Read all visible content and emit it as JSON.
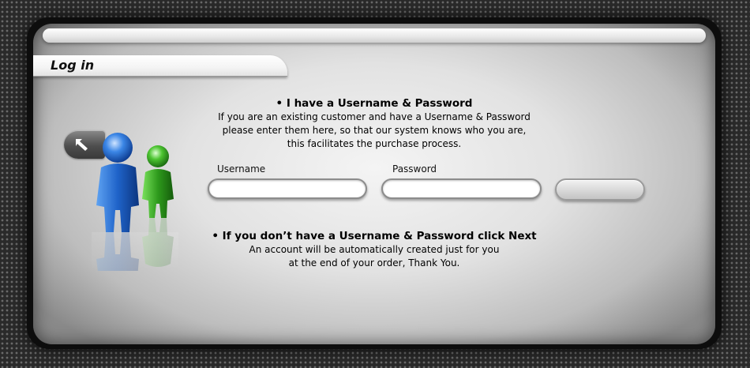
{
  "login": {
    "tab_title": "Log in",
    "existing": {
      "heading": "• I have a Username & Password",
      "lines": [
        "If you are an existing customer and have a Username & Password",
        "please enter them here, so that our system knows who you are,",
        "this facilitates the purchase process."
      ]
    },
    "form": {
      "username_label": "Username",
      "username_value": "",
      "password_label": "Password",
      "password_value": "",
      "next_label": ""
    },
    "new_customer": {
      "heading": "• If you don’t have a Username & Password click Next",
      "lines": [
        "An account will be automatically created just for you",
        "at the end of your order, Thank You."
      ]
    }
  },
  "icons": {
    "back": "arrow-up-left-icon",
    "users": "users-icon"
  },
  "colors": {
    "user_primary": "#1f63c9",
    "user_secondary": "#2e9a1c",
    "panel": "#e2e2e2",
    "frame": "#0d0d0d"
  }
}
